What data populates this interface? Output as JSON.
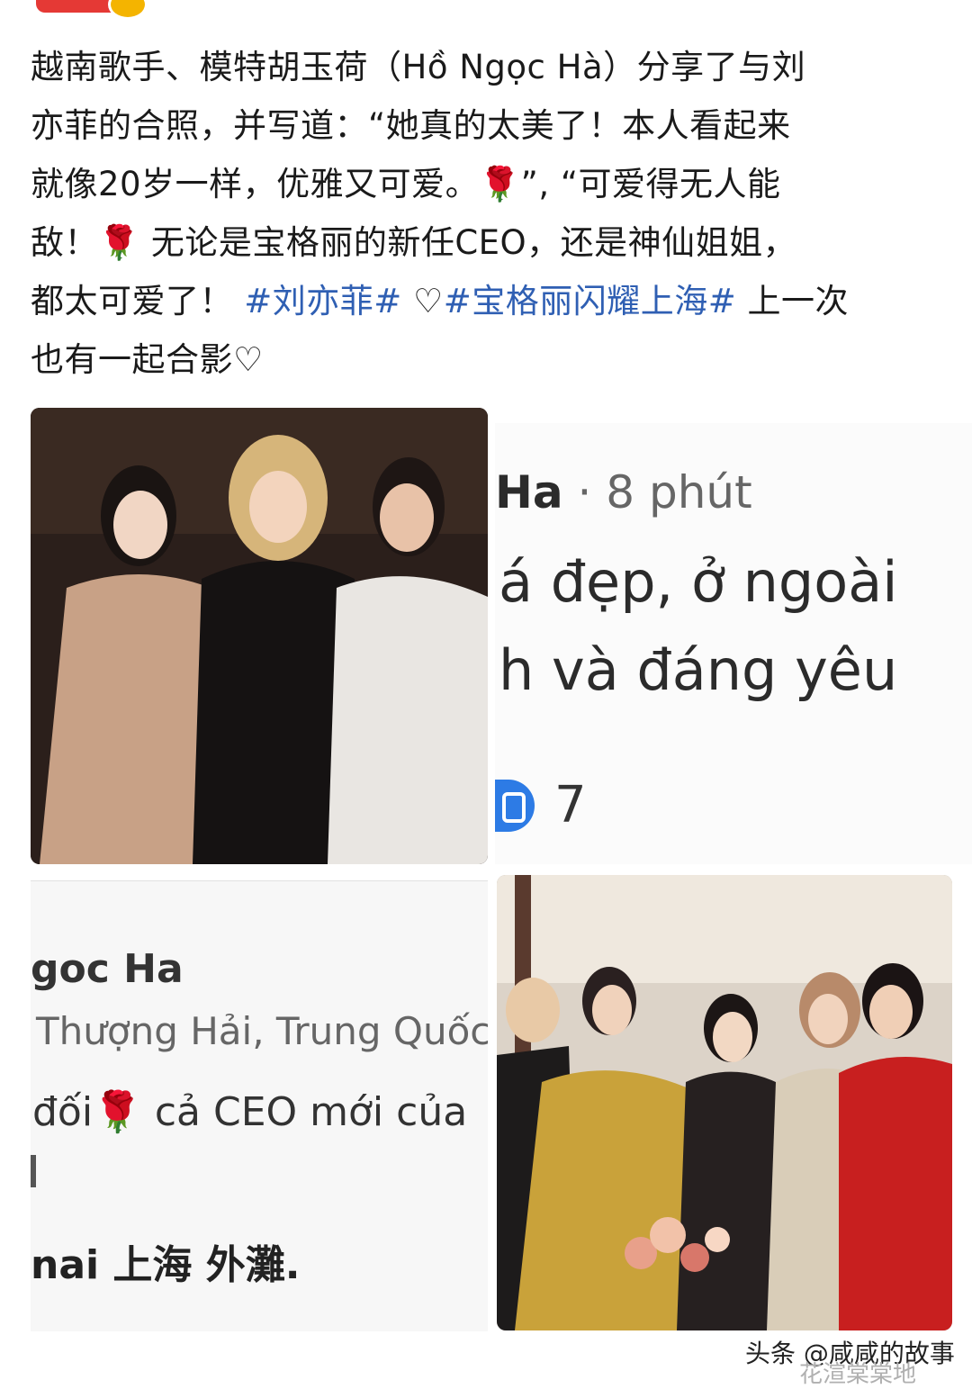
{
  "post": {
    "line1": "越南歌手、模特胡玉荷（Hồ Ngọc Hà）分享了与刘",
    "line2": "亦菲的合照，并写道：“她真的太美了！本人看起来",
    "line3a": "就像20岁一样，优雅又可爱。",
    "line3b": "”, “可爱得无人能",
    "line4a": "敌！",
    "line4b": " 无论是宝格丽的新任CEO，还是神仙姐姐，",
    "line5a": "都太可爱了！",
    "hashtag1": "#刘亦菲#",
    "heart": " ♡",
    "hashtag2": "#宝格丽闪耀上海#",
    "line5b": " 上一次",
    "line6": "也有一起合影♡",
    "rose_emoji": "🌹"
  },
  "fb_top": {
    "name": "Ha",
    "time": " · 8 phút",
    "line1": "á đẹp, ở ngoài",
    "line2": "h và đáng yêu",
    "likes": "7"
  },
  "fb_bottom": {
    "name": "goc Ha",
    "location": "Thượng Hải, Trung Quốc",
    "text": "đối🌹 cả CEO mới của",
    "place": "nai 上海 外灘."
  },
  "watermark": {
    "source": "头条 @咸咸的故事",
    "ghost": "花渲棠棠地"
  },
  "colors": {
    "hashtag": "#2f5fb3",
    "like_blue": "#2d7be5"
  }
}
